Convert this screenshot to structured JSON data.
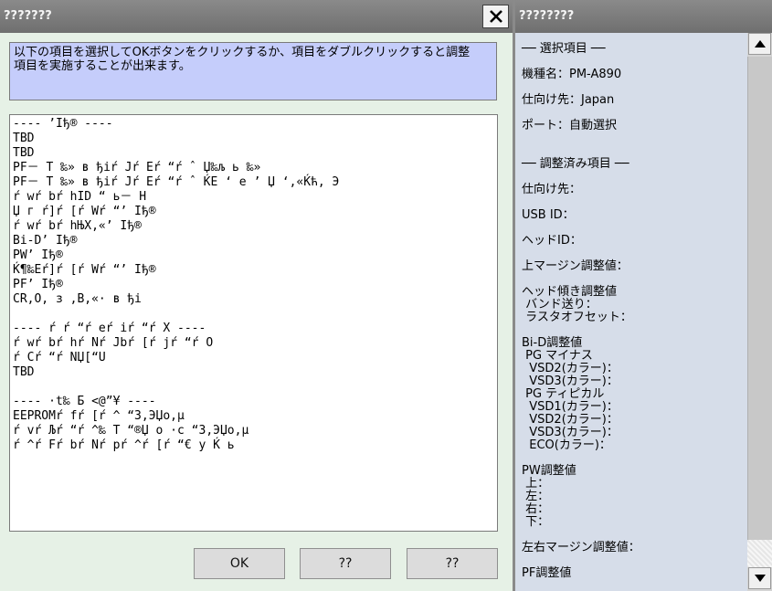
{
  "left_window": {
    "title": "???????",
    "instruction": "以下の項目を選択してOKボタンをクリックするか、項目をダブルクリックすると調整\n項目を実施することが出来ます。",
    "list_items": [
      "---- ’Iђ® ----",
      "TBD",
      "TBD",
      "PF－ T ‰» ʙ ђiŕ Jŕ Eŕ “ŕ ˆ Џ‰љ ь ‰»",
      "PF－ T ‰» ʙ ђiŕ Jŕ Eŕ “ŕ ˆ ЌE ‘ e ’ Џ ‘,«Ќћ, Э",
      "ŕ wŕ bŕ hID “ ь－ H",
      "Џ г ŕ]ŕ [ŕ Wŕ “’ Iђ®",
      "ŕ wŕ bŕ hЊX,«’ Iђ®",
      "Bi-D’ Iђ®",
      "PW’ Iђ®",
      "Ќ¶‰Eŕ]ŕ [ŕ Wŕ “’ Iђ®",
      "PF’ Iђ®",
      "CR,O, з ,B,«· ʙ ђi",
      "",
      "---- ŕ ŕ “ŕ eŕ iŕ “ŕ X ----",
      "ŕ wŕ bŕ hŕ Nŕ Jbŕ [ŕ jŕ “ŕ O",
      "ŕ Cŕ “ŕ NЏ[“U",
      "TBD",
      "",
      "---- ·t‰ Б <@”¥ ----",
      "EEPROMŕ fŕ [ŕ ^ “З,ЭЏo,µ",
      "ŕ vŕ Љŕ “ŕ ^‰ T “®Џ o ·c “З,ЭЏo,µ",
      "ŕ ^ŕ Fŕ bŕ Nŕ pŕ ^ŕ [ŕ “€ y Ќ ь"
    ],
    "buttons": {
      "ok": "OK",
      "second": "??",
      "third": "??"
    }
  },
  "right_panel": {
    "title": "????????",
    "lines": [
      "── 選択項目 ──",
      "機種名：PM-A890",
      "仕向け先：Japan",
      "ポート：自動選択",
      "── 調整済み項目 ──",
      "仕向け先：",
      "USB ID：",
      "ヘッドID：",
      "上マージン調整値：",
      "ヘッド傾き調整値",
      " バンド送り：",
      " ラスタオフセット：",
      "Bi-D調整値",
      " PG マイナス",
      "  VSD2(カラー)：",
      "  VSD3(カラー)：",
      " PG ティピカル",
      "  VSD1(カラー)：",
      "  VSD2(カラー)：",
      "  VSD3(カラー)：",
      "  ECO(カラー)：",
      "PW調整値",
      " 上：",
      " 左：",
      " 右：",
      " 下：",
      "左右マージン調整値：",
      "PF調整値"
    ]
  }
}
